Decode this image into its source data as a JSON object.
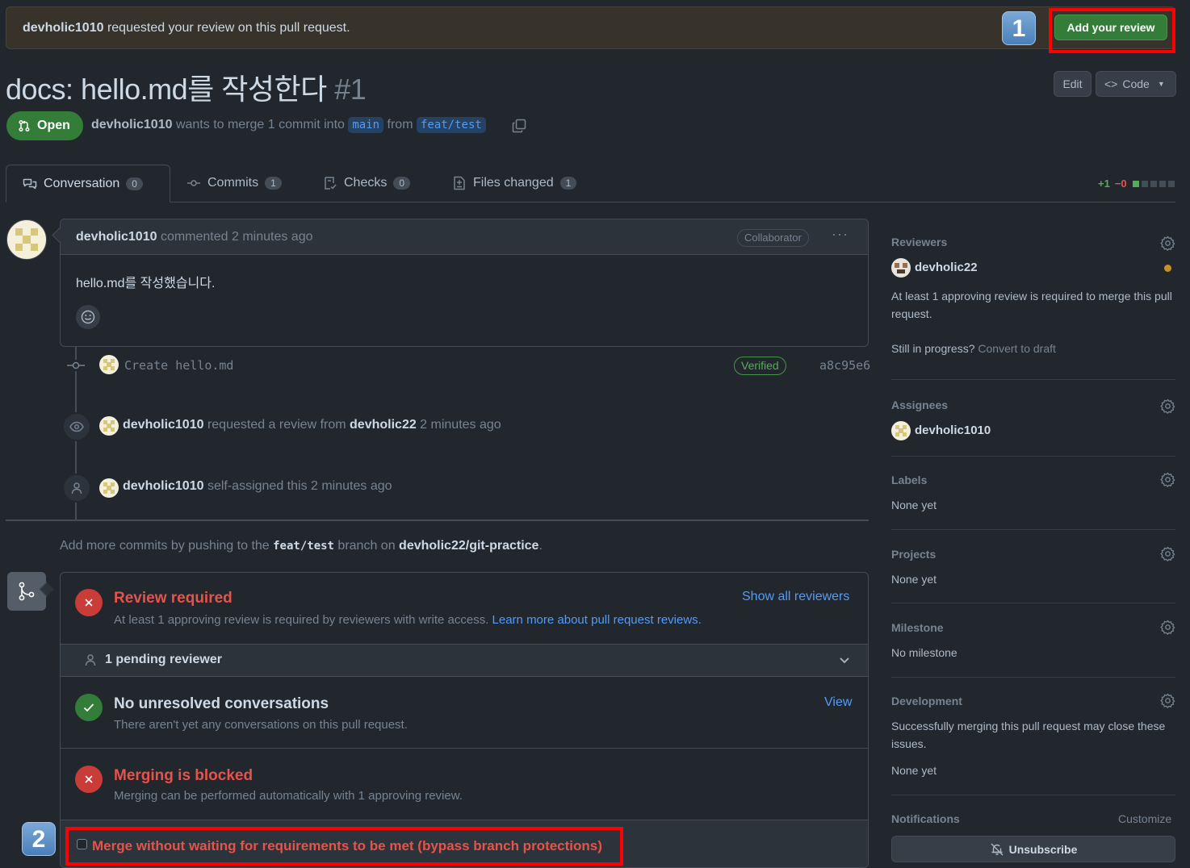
{
  "banner": {
    "user": "devholic1010",
    "text": " requested your review on this pull request.",
    "button": "Add your review",
    "step_badge": "1"
  },
  "pr": {
    "title": "docs: hello.md를 작성한다",
    "number": "#1",
    "edit_label": "Edit",
    "code_label": "Code",
    "state": "Open",
    "author": "devholic1010",
    "merge_text": " wants to merge 1 commit into ",
    "base_branch": "main",
    "from_text": " from ",
    "head_branch": "feat/test"
  },
  "tabs": [
    {
      "label": "Conversation",
      "count": "0"
    },
    {
      "label": "Commits",
      "count": "1"
    },
    {
      "label": "Checks",
      "count": "0"
    },
    {
      "label": "Files changed",
      "count": "1"
    }
  ],
  "diffstat": {
    "additions": "+1",
    "deletions": "−0"
  },
  "comment": {
    "author": "devholic1010",
    "meta": " commented 2 minutes ago",
    "role": "Collaborator",
    "body": "hello.md를 작성했습니다."
  },
  "timeline": {
    "commit_message": "Create hello.md",
    "verified": "Verified",
    "sha": "a8c95e6",
    "review_request_user": "devholic1010",
    "review_request_text": " requested a review from ",
    "review_request_target": "devholic22",
    "review_request_time": " 2 minutes ago",
    "assign_user": "devholic1010",
    "assign_text": " self-assigned this 2 minutes ago"
  },
  "push_hint": {
    "prefix": "Add more commits by pushing to the ",
    "branch": "feat/test",
    "middle": " branch on ",
    "repo": "devholic22/git-practice",
    "suffix": "."
  },
  "merge_box": {
    "review_title": "Review required",
    "review_sub": "At least 1 approving review is required by reviewers with write access. ",
    "review_link": "Learn more about pull request reviews.",
    "show_all": "Show all reviewers",
    "pending": "1 pending reviewer",
    "conv_title": "No unresolved conversations",
    "conv_sub": "There aren't yet any conversations on this pull request.",
    "conv_link": "View",
    "blocked_title": "Merging is blocked",
    "blocked_sub": "Merging can be performed automatically with 1 approving review.",
    "bypass_label": "Merge without waiting for requirements to be met (bypass branch protections)",
    "step_badge": "2"
  },
  "sidebar": {
    "reviewers_h": "Reviewers",
    "reviewer": "devholic22",
    "reviewer_note": "At least 1 approving review is required to merge this pull request.",
    "still": "Still in progress?",
    "convert": " Convert to draft",
    "assignees_h": "Assignees",
    "assignee": "devholic1010",
    "labels_h": "Labels",
    "labels_v": "None yet",
    "projects_h": "Projects",
    "projects_v": "None yet",
    "milestone_h": "Milestone",
    "milestone_v": "No milestone",
    "development_h": "Development",
    "development_note": "Successfully merging this pull request may close these issues.",
    "development_v": "None yet",
    "notifications_h": "Notifications",
    "customize": "Customize",
    "unsubscribe": "Unsubscribe"
  },
  "colors": {
    "accent": "#539bf5",
    "danger": "#e5534b",
    "success": "#57ab5a",
    "highlight": "#ff0000"
  }
}
